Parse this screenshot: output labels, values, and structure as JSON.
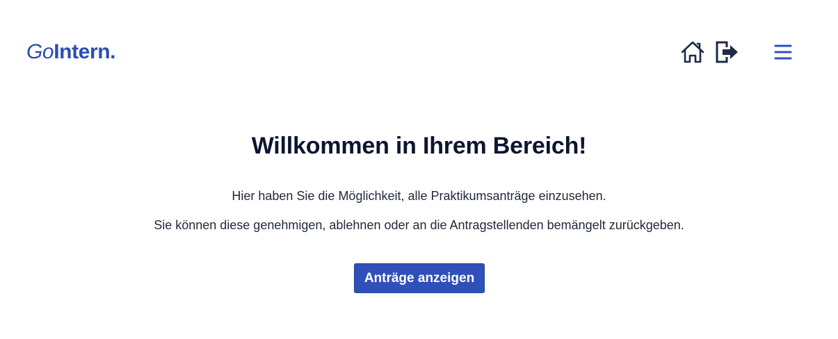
{
  "header": {
    "logo": {
      "part_italic": "Go",
      "part_bold": "Intern."
    },
    "icons": {
      "home": "home-icon",
      "logout": "logout-icon",
      "menu": "hamburger-menu-icon"
    }
  },
  "main": {
    "title": "Willkommen in Ihrem Bereich!",
    "intro": "Hier haben Sie die Möglichkeit, alle Praktikumsanträge einzusehen.",
    "description": "Sie können diese genehmigen, ablehnen oder an die Antragstellenden bemängelt zurückgeben.",
    "button_label": "Anträge anzeigen"
  },
  "colors": {
    "brand_blue": "#2f50b8",
    "heading": "#0e1530",
    "text": "#1f2937",
    "icon_dark": "#1f2a44",
    "background": "#ffffff"
  }
}
